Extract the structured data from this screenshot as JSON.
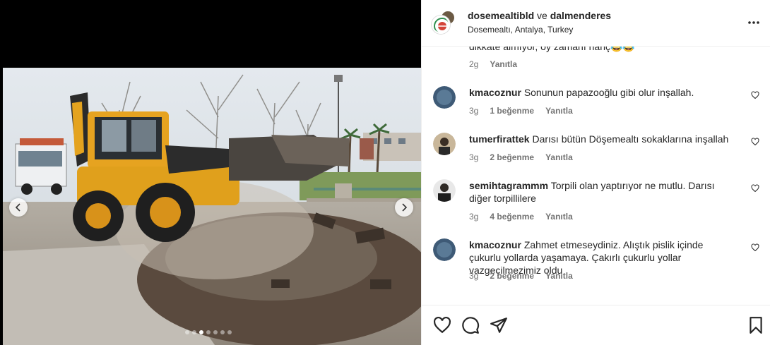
{
  "post": {
    "image_alt": "",
    "carousel": {
      "total": 7,
      "active_index": 2
    }
  },
  "header": {
    "user1": "dosemealtibld",
    "conjunction": "ve",
    "user2": "dalmenderes",
    "location": "Dosemealtı, Antalya, Turkey"
  },
  "partial_comment": {
    "text_tail": "dikkate almıyor, oy zamanı hanç😂😂",
    "time": "2g",
    "reply": "Yanıtla"
  },
  "comments": [
    {
      "user": "kmacoznur",
      "text": "Sonunun papazooğlu gibi olur inşallah.",
      "time": "3g",
      "likes": "1 beğenme",
      "reply": "Yanıtla"
    },
    {
      "user": "tumerfirattek",
      "text": "Darısı bütün Döşemealtı sokaklarına inşallah",
      "time": "3g",
      "likes": "2 beğenme",
      "reply": "Yanıtla"
    },
    {
      "user": "semihtagrammm",
      "text": "Torpili olan yaptırıyor ne mutlu. Darısı diğer torpillilere",
      "time": "3g",
      "likes": "4 beğenme",
      "reply": "Yanıtla"
    },
    {
      "user": "kmacoznur",
      "text": "Zahmet etmeseydiniz. Alıştık pislik içinde çukurlu yollarda yaşamaya. Çakırlı çukurlu yollar vazgeçilmezimiz oldu",
      "time": "3g",
      "likes": "2 beğenme",
      "reply": "Yanıtla"
    }
  ],
  "colors": {
    "text": "#262626",
    "muted": "#737373",
    "border": "#efefef"
  }
}
